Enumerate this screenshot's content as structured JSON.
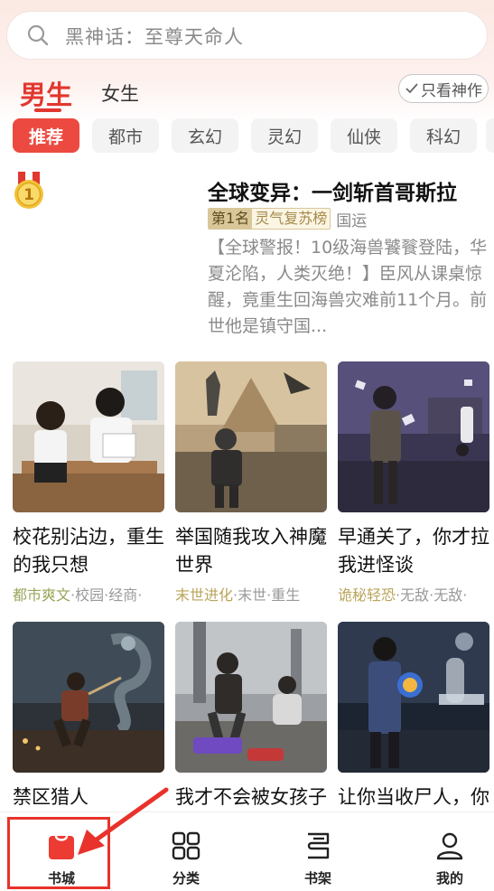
{
  "search": {
    "placeholder": "黑神话：至尊天命人"
  },
  "gender": {
    "male": "男生",
    "female": "女生",
    "only_best": "只看神作"
  },
  "categories": [
    "推荐",
    "都市",
    "玄幻",
    "灵幻",
    "仙侠",
    "科幻"
  ],
  "featured": {
    "rank_number": "1",
    "title": "全球变异：一剑斩首哥斯拉",
    "rank_label": "第1名",
    "rank_list": "灵气复苏榜",
    "genre": "国运",
    "description": "【全球警报！10级海兽饕餮登陆，华夏沦陷，人类灭绝！】臣风从课桌惊醒，竟重生回海兽灾难前11个月。前世他是镇守国..."
  },
  "books": [
    {
      "title": "校花别沾边，重生的我只想",
      "tag_main": "都市爽文",
      "tag_rest": "·校园·经商·"
    },
    {
      "title": "举国随我攻入神魔世界",
      "tag_main": "末世进化",
      "tag_rest": "·末世·重生"
    },
    {
      "title": "早通关了，你才拉我进怪谈",
      "tag_main": "诡秘轻恐",
      "tag_rest": "·无敌·无敌·"
    },
    {
      "title": "禁区猎人",
      "tag_main": "",
      "tag_rest": ""
    },
    {
      "title": "我才不会被女孩子带坏呢",
      "tag_main": "",
      "tag_rest": ""
    },
    {
      "title": "让你当收尸人，你直接解",
      "tag_main": "",
      "tag_rest": ""
    }
  ],
  "tabbar": [
    {
      "label": "书城",
      "icon": "bookstore-bag-icon",
      "active": true
    },
    {
      "label": "分类",
      "icon": "grid-icon",
      "active": false
    },
    {
      "label": "书架",
      "icon": "bookshelf-icon",
      "active": false
    },
    {
      "label": "我的",
      "icon": "user-icon",
      "active": false
    }
  ],
  "colors": {
    "accent": "#e2372e",
    "annotation": "#e8322b"
  }
}
